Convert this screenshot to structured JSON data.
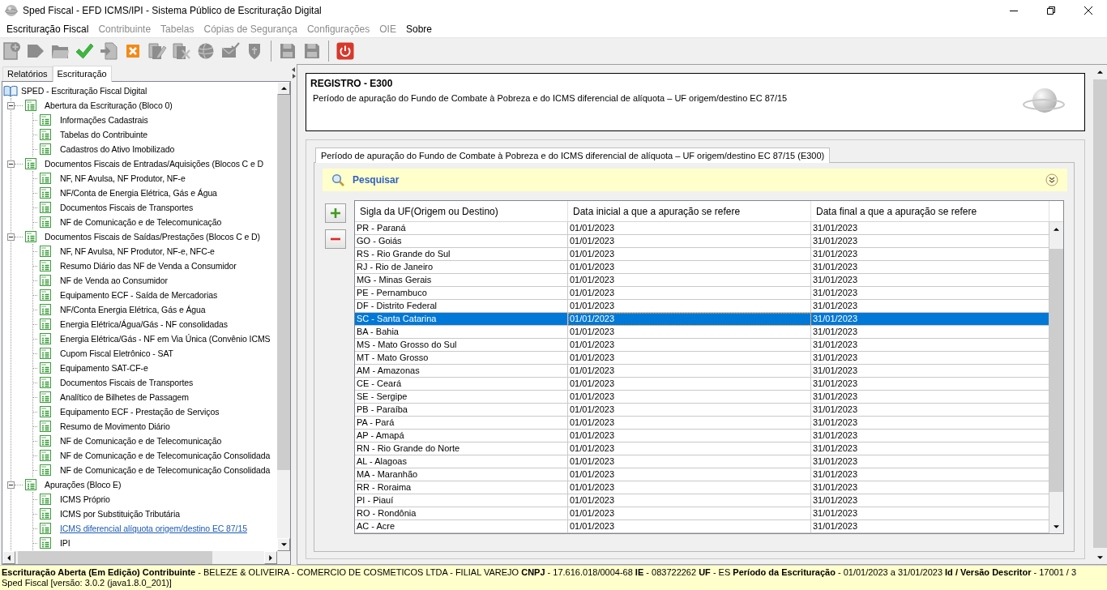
{
  "window": {
    "title": "Sped Fiscal - EFD ICMS/IPI - Sistema Público de Escrituração Digital"
  },
  "menu": [
    {
      "label": "Escrituração Fiscal",
      "disabled": false
    },
    {
      "label": "Contribuinte",
      "disabled": true
    },
    {
      "label": "Tabelas",
      "disabled": true
    },
    {
      "label": "Cópias de Segurança",
      "disabled": true
    },
    {
      "label": "Configurações",
      "disabled": true
    },
    {
      "label": "OIE",
      "disabled": true
    },
    {
      "label": "Sobre",
      "disabled": false
    }
  ],
  "toolbar": {
    "groups": [
      [
        {
          "disabled": true
        },
        {
          "disabled": true
        },
        {
          "disabled": true
        },
        {
          "disabled": false
        },
        {
          "disabled": true
        },
        {
          "disabled": false
        },
        {
          "disabled": true
        },
        {
          "disabled": true
        },
        {
          "disabled": true
        },
        {
          "disabled": true
        },
        {
          "disabled": true
        }
      ],
      [
        {
          "disabled": true
        },
        {
          "disabled": true
        }
      ],
      [
        {
          "disabled": false
        }
      ]
    ]
  },
  "left_panel": {
    "tabs": [
      {
        "label": "Relatórios",
        "selected": false
      },
      {
        "label": "Escrituração",
        "selected": true
      }
    ],
    "tree": {
      "label": "SPED - Escrituração Fiscal Digital",
      "selected": false,
      "children": [
        {
          "label": "Abertura da Escrituração (Bloco 0)",
          "expanded": true,
          "selected": false,
          "children": [
            {
              "label": "Informações Cadastrais",
              "selected": false
            },
            {
              "label": "Tabelas do Contribuinte",
              "selected": false
            },
            {
              "label": "Cadastros do Ativo Imobilizado",
              "selected": false
            }
          ]
        },
        {
          "label": "Documentos Fiscais de Entradas/Aquisições (Blocos C e D",
          "expanded": true,
          "selected": false,
          "children": [
            {
              "label": "NF, NF Avulsa, NF Produtor, NF-e",
              "selected": false
            },
            {
              "label": "NF/Conta de Energia Elétrica, Gás e Água",
              "selected": false
            },
            {
              "label": "Documentos Fiscais de Transportes",
              "selected": false
            },
            {
              "label": "NF de Comunicação e de Telecomunicação",
              "selected": false
            }
          ]
        },
        {
          "label": "Documentos Fiscais de Saídas/Prestações (Blocos C e D)",
          "expanded": true,
          "selected": false,
          "children": [
            {
              "label": "NF, NF Avulsa, NF Produtor, NF-e, NFC-e",
              "selected": false
            },
            {
              "label": "Resumo Diário das NF de Venda a Consumidor",
              "selected": false
            },
            {
              "label": "NF de Venda ao Consumidor",
              "selected": false
            },
            {
              "label": "Equipamento ECF - Saída de Mercadorias",
              "selected": false
            },
            {
              "label": "NF/Conta Energia Elétrica, Gás e Água",
              "selected": false
            },
            {
              "label": "Energia Elétrica/Água/Gás - NF consolidadas",
              "selected": false
            },
            {
              "label": "Energia Elétrica/Gás - NF em Via Única (Convênio ICMS",
              "selected": false
            },
            {
              "label": "Cupom Fiscal Eletrônico - SAT",
              "selected": false
            },
            {
              "label": "Equipamento SAT-CF-e",
              "selected": false
            },
            {
              "label": "Documentos Fiscais de Transportes",
              "selected": false
            },
            {
              "label": "Analítico de Bilhetes de Passagem",
              "selected": false
            },
            {
              "label": "Equipamento ECF - Prestação de Serviços",
              "selected": false
            },
            {
              "label": "Resumo de Movimento Diário",
              "selected": false
            },
            {
              "label": "NF de Comunicação e de Telecomunicação",
              "selected": false
            },
            {
              "label": "NF de Comunicação e de Telecomunicação Consolidada",
              "selected": false
            },
            {
              "label": "NF de Comunicação e de Telecomunicação Consolidada",
              "selected": false
            }
          ]
        },
        {
          "label": "Apurações (Bloco E)",
          "expanded": true,
          "selected": false,
          "children": [
            {
              "label": "ICMS Próprio",
              "selected": false
            },
            {
              "label": "ICMS por Substituição Tributária",
              "selected": false
            },
            {
              "label": "ICMS diferencial alíquota origem/destino EC 87/15",
              "selected": true
            },
            {
              "label": "IPI",
              "selected": false
            }
          ]
        }
      ]
    }
  },
  "register": {
    "title": "REGISTRO - E300",
    "description": "Período de apuração do Fundo de Combate à Pobreza e do ICMS diferencial de alíquota – UF origem/destino EC 87/15"
  },
  "form": {
    "tabs": [
      {
        "label": "Período de apuração do Fundo de Combate à Pobreza e do ICMS diferencial de alíquota – UF origem/destino EC 87/15 (E300)",
        "selected": true
      }
    ],
    "search": {
      "label": "Pesquisar",
      "expanded": false
    },
    "table": {
      "columns": [
        {
          "label": "Sigla da UF(Origem ou Destino)",
          "focused": false
        },
        {
          "label": "Data inicial a que a apuração se refere",
          "focused": true
        },
        {
          "label": "Data final a que a apuração se refere",
          "focused": false
        }
      ],
      "rows": [
        {
          "cells": [
            "PR - Paraná",
            "01/01/2023",
            "31/01/2023"
          ],
          "selected": false
        },
        {
          "cells": [
            "GO - Goiás",
            "01/01/2023",
            "31/01/2023"
          ],
          "selected": false
        },
        {
          "cells": [
            "RS - Rio Grande do Sul",
            "01/01/2023",
            "31/01/2023"
          ],
          "selected": false
        },
        {
          "cells": [
            "RJ - Rio de Janeiro",
            "01/01/2023",
            "31/01/2023"
          ],
          "selected": false
        },
        {
          "cells": [
            "MG - Minas Gerais",
            "01/01/2023",
            "31/01/2023"
          ],
          "selected": false
        },
        {
          "cells": [
            "PE - Pernambuco",
            "01/01/2023",
            "31/01/2023"
          ],
          "selected": false
        },
        {
          "cells": [
            "DF - Distrito Federal",
            "01/01/2023",
            "31/01/2023"
          ],
          "selected": false
        },
        {
          "cells": [
            "SC - Santa Catarina",
            "01/01/2023",
            "31/01/2023"
          ],
          "selected": true
        },
        {
          "cells": [
            "BA - Bahia",
            "01/01/2023",
            "31/01/2023"
          ],
          "selected": false
        },
        {
          "cells": [
            "MS - Mato Grosso do Sul",
            "01/01/2023",
            "31/01/2023"
          ],
          "selected": false
        },
        {
          "cells": [
            "MT - Mato Grosso",
            "01/01/2023",
            "31/01/2023"
          ],
          "selected": false
        },
        {
          "cells": [
            "AM - Amazonas",
            "01/01/2023",
            "31/01/2023"
          ],
          "selected": false
        },
        {
          "cells": [
            "CE - Ceará",
            "01/01/2023",
            "31/01/2023"
          ],
          "selected": false
        },
        {
          "cells": [
            "SE - Sergipe",
            "01/01/2023",
            "31/01/2023"
          ],
          "selected": false
        },
        {
          "cells": [
            "PB - Paraíba",
            "01/01/2023",
            "31/01/2023"
          ],
          "selected": false
        },
        {
          "cells": [
            "PA - Pará",
            "01/01/2023",
            "31/01/2023"
          ],
          "selected": false
        },
        {
          "cells": [
            "AP - Amapá",
            "01/01/2023",
            "31/01/2023"
          ],
          "selected": false
        },
        {
          "cells": [
            "RN - Rio Grande do Norte",
            "01/01/2023",
            "31/01/2023"
          ],
          "selected": false
        },
        {
          "cells": [
            "AL - Alagoas",
            "01/01/2023",
            "31/01/2023"
          ],
          "selected": false
        },
        {
          "cells": [
            "MA - Maranhão",
            "01/01/2023",
            "31/01/2023"
          ],
          "selected": false
        },
        {
          "cells": [
            "RR - Roraima",
            "01/01/2023",
            "31/01/2023"
          ],
          "selected": false
        },
        {
          "cells": [
            "PI - Piauí",
            "01/01/2023",
            "31/01/2023"
          ],
          "selected": false
        },
        {
          "cells": [
            "RO - Rondônia",
            "01/01/2023",
            "31/01/2023"
          ],
          "selected": false
        },
        {
          "cells": [
            "AC - Acre",
            "01/01/2023",
            "31/01/2023"
          ],
          "selected": false
        }
      ]
    }
  },
  "status_bar": {
    "line_1": "**Escrituração Aberta (Em Edição) Contribuinte** - BELEZE & OLIVEIRA - COMERCIO DE COSMETICOS LTDA - FILIAL VAREJO **CNPJ** - 17.616.018/0004-68 **IE** - 083722262 **UF** - ES **Período da Escrituração** - 01/01/2023 a 31/01/2023 **Id / Versão Descritor** - 17001 / 3",
    "line_2": "Sped Fiscal [versão: 3.0.2 (java1.8.0_201)]"
  }
}
